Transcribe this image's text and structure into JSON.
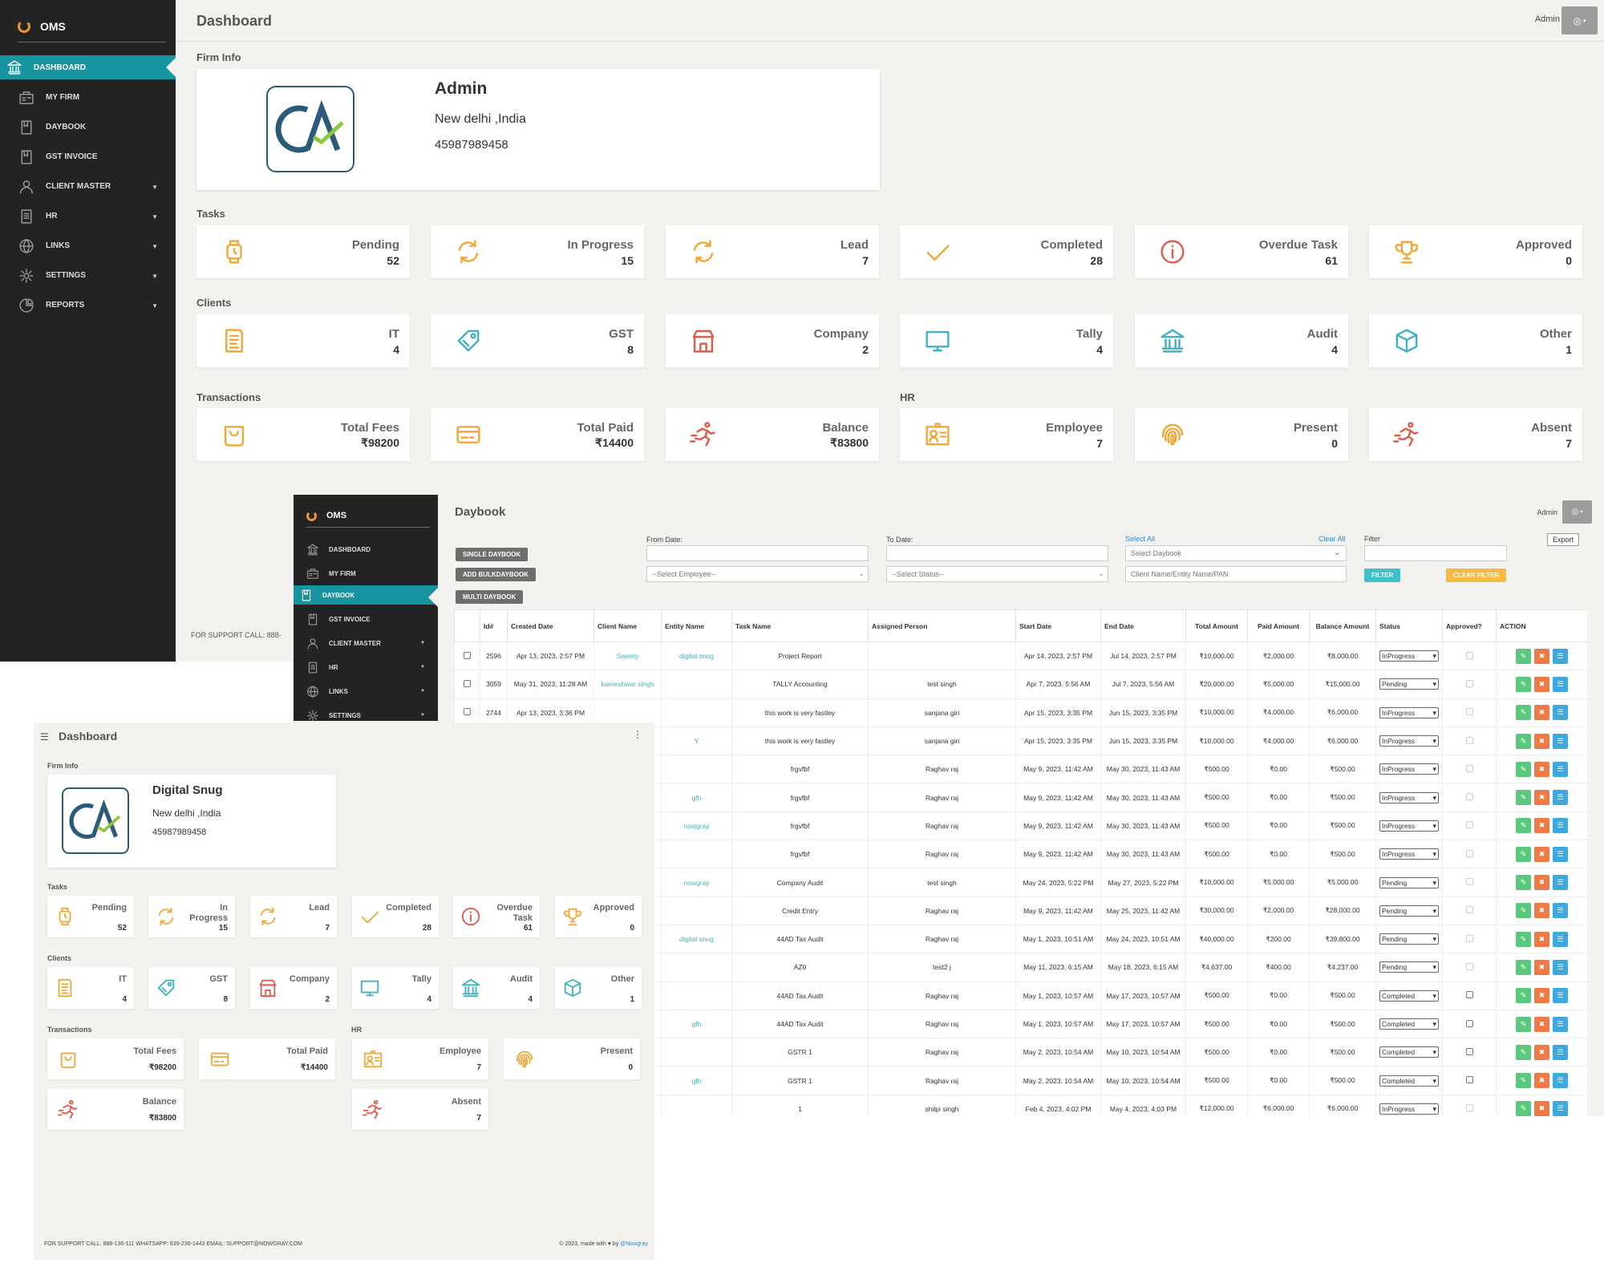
{
  "app": {
    "name": "OMS",
    "page_title": "Dashboard",
    "user": "Admin"
  },
  "nav": [
    {
      "label": "DASHBOARD",
      "icon": "bank-icon"
    },
    {
      "label": "MY FIRM",
      "icon": "firm-icon"
    },
    {
      "label": "DAYBOOK",
      "icon": "book-icon"
    },
    {
      "label": "GST INVOICE",
      "icon": "invoice-icon"
    },
    {
      "label": "CLIENT MASTER",
      "icon": "user-icon"
    },
    {
      "label": "HR",
      "icon": "document-icon"
    },
    {
      "label": "LINKS",
      "icon": "globe-icon"
    },
    {
      "label": "SETTINGS",
      "icon": "gear-icon"
    },
    {
      "label": "REPORTS",
      "icon": "pie-chart-icon"
    }
  ],
  "sections": {
    "firm_info": "Firm Info",
    "tasks": "Tasks",
    "clients": "Clients",
    "transactions": "Transactions",
    "hr": "HR"
  },
  "firm": {
    "name": "Admin",
    "address": "New delhi ,India",
    "phone": "45987989458"
  },
  "tasks": [
    {
      "label": "Pending",
      "value": "52",
      "icon": "watch-icon"
    },
    {
      "label": "In Progress",
      "value": "15",
      "icon": "refresh-icon"
    },
    {
      "label": "Lead",
      "value": "7",
      "icon": "refresh-icon"
    },
    {
      "label": "Completed",
      "value": "28",
      "icon": "check-icon"
    },
    {
      "label": "Overdue Task",
      "value": "61",
      "icon": "info-icon"
    },
    {
      "label": "Approved",
      "value": "0",
      "icon": "trophy-icon"
    }
  ],
  "clients": [
    {
      "label": "IT",
      "value": "4",
      "icon": "receipt-icon"
    },
    {
      "label": "GST",
      "value": "8",
      "icon": "tag-icon"
    },
    {
      "label": "Company",
      "value": "2",
      "icon": "store-icon"
    },
    {
      "label": "Tally",
      "value": "4",
      "icon": "monitor-icon"
    },
    {
      "label": "Audit",
      "value": "4",
      "icon": "bank-icon"
    },
    {
      "label": "Other",
      "value": "1",
      "icon": "box-icon"
    }
  ],
  "transactions": [
    {
      "label": "Total Fees",
      "value": "₹98200",
      "icon": "bag-icon"
    },
    {
      "label": "Total Paid",
      "value": "₹14400",
      "icon": "card-icon"
    },
    {
      "label": "Balance",
      "value": "₹83800",
      "icon": "runner-icon"
    }
  ],
  "hr": [
    {
      "label": "Employee",
      "value": "7",
      "icon": "id-card-icon"
    },
    {
      "label": "Present",
      "value": "0",
      "icon": "fingerprint-icon"
    },
    {
      "label": "Absent",
      "value": "7",
      "icon": "runner-icon"
    }
  ],
  "support_short": "FOR SUPPORT     CALL: 888-",
  "daybook": {
    "title": "Daybook",
    "buttons": {
      "single": "SINGLE DAYBOOK",
      "bulk": "ADD BULKDAYBOOK",
      "multi": "MULTI DAYBOOK",
      "filter": "FILTER",
      "clear": "CLEAR FILTER",
      "export": "Export"
    },
    "filters": {
      "from_label": "From Date:",
      "to_label": "To Date:",
      "select_all": "Select All",
      "clear_all": "Clear All",
      "filter_label": "Filter",
      "employee_placeholder": "--Select Employee--",
      "status_placeholder": "--Select Status--",
      "daybook_placeholder": "Select Daybook",
      "client_placeholder": "Client Name/Entity Name/PAN"
    },
    "columns": [
      "",
      "Id#",
      "Created Date",
      "Client Name",
      "Entity Name",
      "Task Name",
      "Assigned Person",
      "Start Date",
      "End Date",
      "Total Amount",
      "Paid Amount",
      "Balance Amount",
      "Status",
      "Approved?",
      "ACTION"
    ],
    "rows": [
      {
        "id": "2596",
        "created": "Apr 13, 2023, 2:57 PM",
        "client": "Sweety",
        "entity": "digital snug",
        "task": "Project Report",
        "person": "",
        "start": "Apr 14, 2023, 2:57 PM",
        "end": "Jul 14, 2023, 2:57 PM",
        "total": "₹10,000.00",
        "paid": "₹2,000.00",
        "balance": "₹8,000.00",
        "status": "InProgress"
      },
      {
        "id": "3059",
        "created": "May 31, 2023, 11:28 AM",
        "client": "kameshwar singh",
        "entity": "",
        "task": "TALLY Accounting",
        "person": "test singh",
        "start": "Apr 7, 2023, 5:56 AM",
        "end": "Jul 7, 2023, 5:56 AM",
        "total": "₹20,000.00",
        "paid": "₹5,000.00",
        "balance": "₹15,000.00",
        "status": "Pending"
      },
      {
        "id": "2744",
        "created": "Apr 13, 2023, 3:36 PM",
        "client": "",
        "entity": "",
        "task": "this work is very fastley",
        "person": "sanjana giri",
        "start": "Apr 15, 2023, 3:35 PM",
        "end": "Jun 15, 2023, 3:35 PM",
        "total": "₹10,000.00",
        "paid": "₹4,000.00",
        "balance": "₹6,000.00",
        "status": "InProgress"
      },
      {
        "id": "",
        "created": "",
        "client": "",
        "entity": "Y",
        "task": "this work is very fastley",
        "person": "sanjana giri",
        "start": "Apr 15, 2023, 3:35 PM",
        "end": "Jun 15, 2023, 3:35 PM",
        "total": "₹10,000.00",
        "paid": "₹4,000.00",
        "balance": "₹6,000.00",
        "status": "InProgress"
      },
      {
        "id": "",
        "created": "",
        "client": "",
        "entity": "",
        "task": "frgvfbf",
        "person": "Raghav raj",
        "start": "May 9, 2023, 11:42 AM",
        "end": "May 30, 2023, 11:43 AM",
        "total": "₹500.00",
        "paid": "₹0.00",
        "balance": "₹500.00",
        "status": "InProgress"
      },
      {
        "id": "",
        "created": "",
        "client": "",
        "entity": "gfh",
        "task": "frgvfbf",
        "person": "Raghav raj",
        "start": "May 9, 2023, 11:42 AM",
        "end": "May 30, 2023, 11:43 AM",
        "total": "₹500.00",
        "paid": "₹0.00",
        "balance": "₹500.00",
        "status": "InProgress"
      },
      {
        "id": "",
        "created": "",
        "client": "",
        "entity": "nowgray",
        "task": "frgvfbf",
        "person": "Raghav raj",
        "start": "May 9, 2023, 11:42 AM",
        "end": "May 30, 2023, 11:43 AM",
        "total": "₹500.00",
        "paid": "₹0.00",
        "balance": "₹500.00",
        "status": "InProgress"
      },
      {
        "id": "",
        "created": "",
        "client": "",
        "entity": "",
        "task": "frgvfbf",
        "person": "Raghav raj",
        "start": "May 9, 2023, 11:42 AM",
        "end": "May 30, 2023, 11:43 AM",
        "total": "₹500.00",
        "paid": "₹0.00",
        "balance": "₹500.00",
        "status": "InProgress"
      },
      {
        "id": "",
        "created": "",
        "client": "",
        "entity": "nowgray",
        "task": "Company Audit",
        "person": "test singh",
        "start": "May 24, 2023, 5:22 PM",
        "end": "May 27, 2023, 5:22 PM",
        "total": "₹10,000.00",
        "paid": "₹5,000.00",
        "balance": "₹5,000.00",
        "status": "Pending"
      },
      {
        "id": "",
        "created": "",
        "client": "",
        "entity": "",
        "task": "Credit Entry",
        "person": "Raghav raj",
        "start": "May 9, 2023, 11:42 AM",
        "end": "May 25, 2023, 11:42 AM",
        "total": "₹30,000.00",
        "paid": "₹2,000.00",
        "balance": "₹28,000.00",
        "status": "Pending"
      },
      {
        "id": "",
        "created": "",
        "client": "",
        "entity": "digital snug",
        "task": "44AD Tax Audit",
        "person": "Raghav raj",
        "start": "May 1, 2023, 10:51 AM",
        "end": "May 24, 2023, 10:51 AM",
        "total": "₹40,000.00",
        "paid": "₹200.00",
        "balance": "₹39,800.00",
        "status": "Pending"
      },
      {
        "id": "",
        "created": "",
        "client": "",
        "entity": "",
        "task": "AZ0",
        "person": "test2 j",
        "start": "May 11, 2023, 6:15 AM",
        "end": "May 18, 2023, 6:15 AM",
        "total": "₹4,637.00",
        "paid": "₹400.00",
        "balance": "₹4,237.00",
        "status": "Pending"
      },
      {
        "id": "",
        "created": "",
        "client": "",
        "entity": "",
        "task": "44AD Tax Audit",
        "person": "Raghav raj",
        "start": "May 1, 2023, 10:57 AM",
        "end": "May 17, 2023, 10:57 AM",
        "total": "₹500.00",
        "paid": "₹0.00",
        "balance": "₹500.00",
        "status": "Completed"
      },
      {
        "id": "",
        "created": "",
        "client": "",
        "entity": "gfh",
        "task": "44AD Tax Audit",
        "person": "Raghav raj",
        "start": "May 1, 2023, 10:57 AM",
        "end": "May 17, 2023, 10:57 AM",
        "total": "₹500.00",
        "paid": "₹0.00",
        "balance": "₹500.00",
        "status": "Completed"
      },
      {
        "id": "",
        "created": "",
        "client": "",
        "entity": "",
        "task": "GSTR 1",
        "person": "Raghav raj",
        "start": "May 2, 2023, 10:54 AM",
        "end": "May 10, 2023, 10:54 AM",
        "total": "₹500.00",
        "paid": "₹0.00",
        "balance": "₹500.00",
        "status": "Completed"
      },
      {
        "id": "",
        "created": "",
        "client": "",
        "entity": "gfh",
        "task": "GSTR 1",
        "person": "Raghav raj",
        "start": "May 2, 2023, 10:54 AM",
        "end": "May 10, 2023, 10:54 AM",
        "total": "₹500.00",
        "paid": "₹0.00",
        "balance": "₹500.00",
        "status": "Completed"
      },
      {
        "id": "",
        "created": "",
        "client": "",
        "entity": "",
        "task": "1",
        "person": "shilpi singh",
        "start": "Feb 4, 2023, 4:02 PM",
        "end": "May 4, 2023, 4:03 PM",
        "total": "₹12,000.00",
        "paid": "₹6,000.00",
        "balance": "₹6,000.00",
        "status": "InProgress"
      }
    ]
  },
  "compact": {
    "firm_name": "Digital Snug",
    "tasks_labels": [
      "Pending",
      "In Progress",
      "Lead",
      "Completed",
      "Overdue Task",
      "Approved"
    ],
    "support": "FOR SUPPORT     CALL: 888-136-111     WHATSAPP: 639-236-1443     EMAIL: SUPPORT@NOWGRAY.COM",
    "copyright": "© 2023, made with ♥ by ",
    "copyright_link": "@Nowgray"
  },
  "colors": {
    "sidebar": "#232323",
    "accent": "#17949f",
    "icon_orange": "#f0a83a",
    "icon_teal": "#3fb4c0",
    "icon_red": "#e25a4a",
    "edit_green": "#5cc87d",
    "delete_orange": "#f07a45",
    "view_blue": "#3ea8df",
    "filter_teal": "#3fc1cb",
    "clear_yellow": "#f5b944"
  }
}
